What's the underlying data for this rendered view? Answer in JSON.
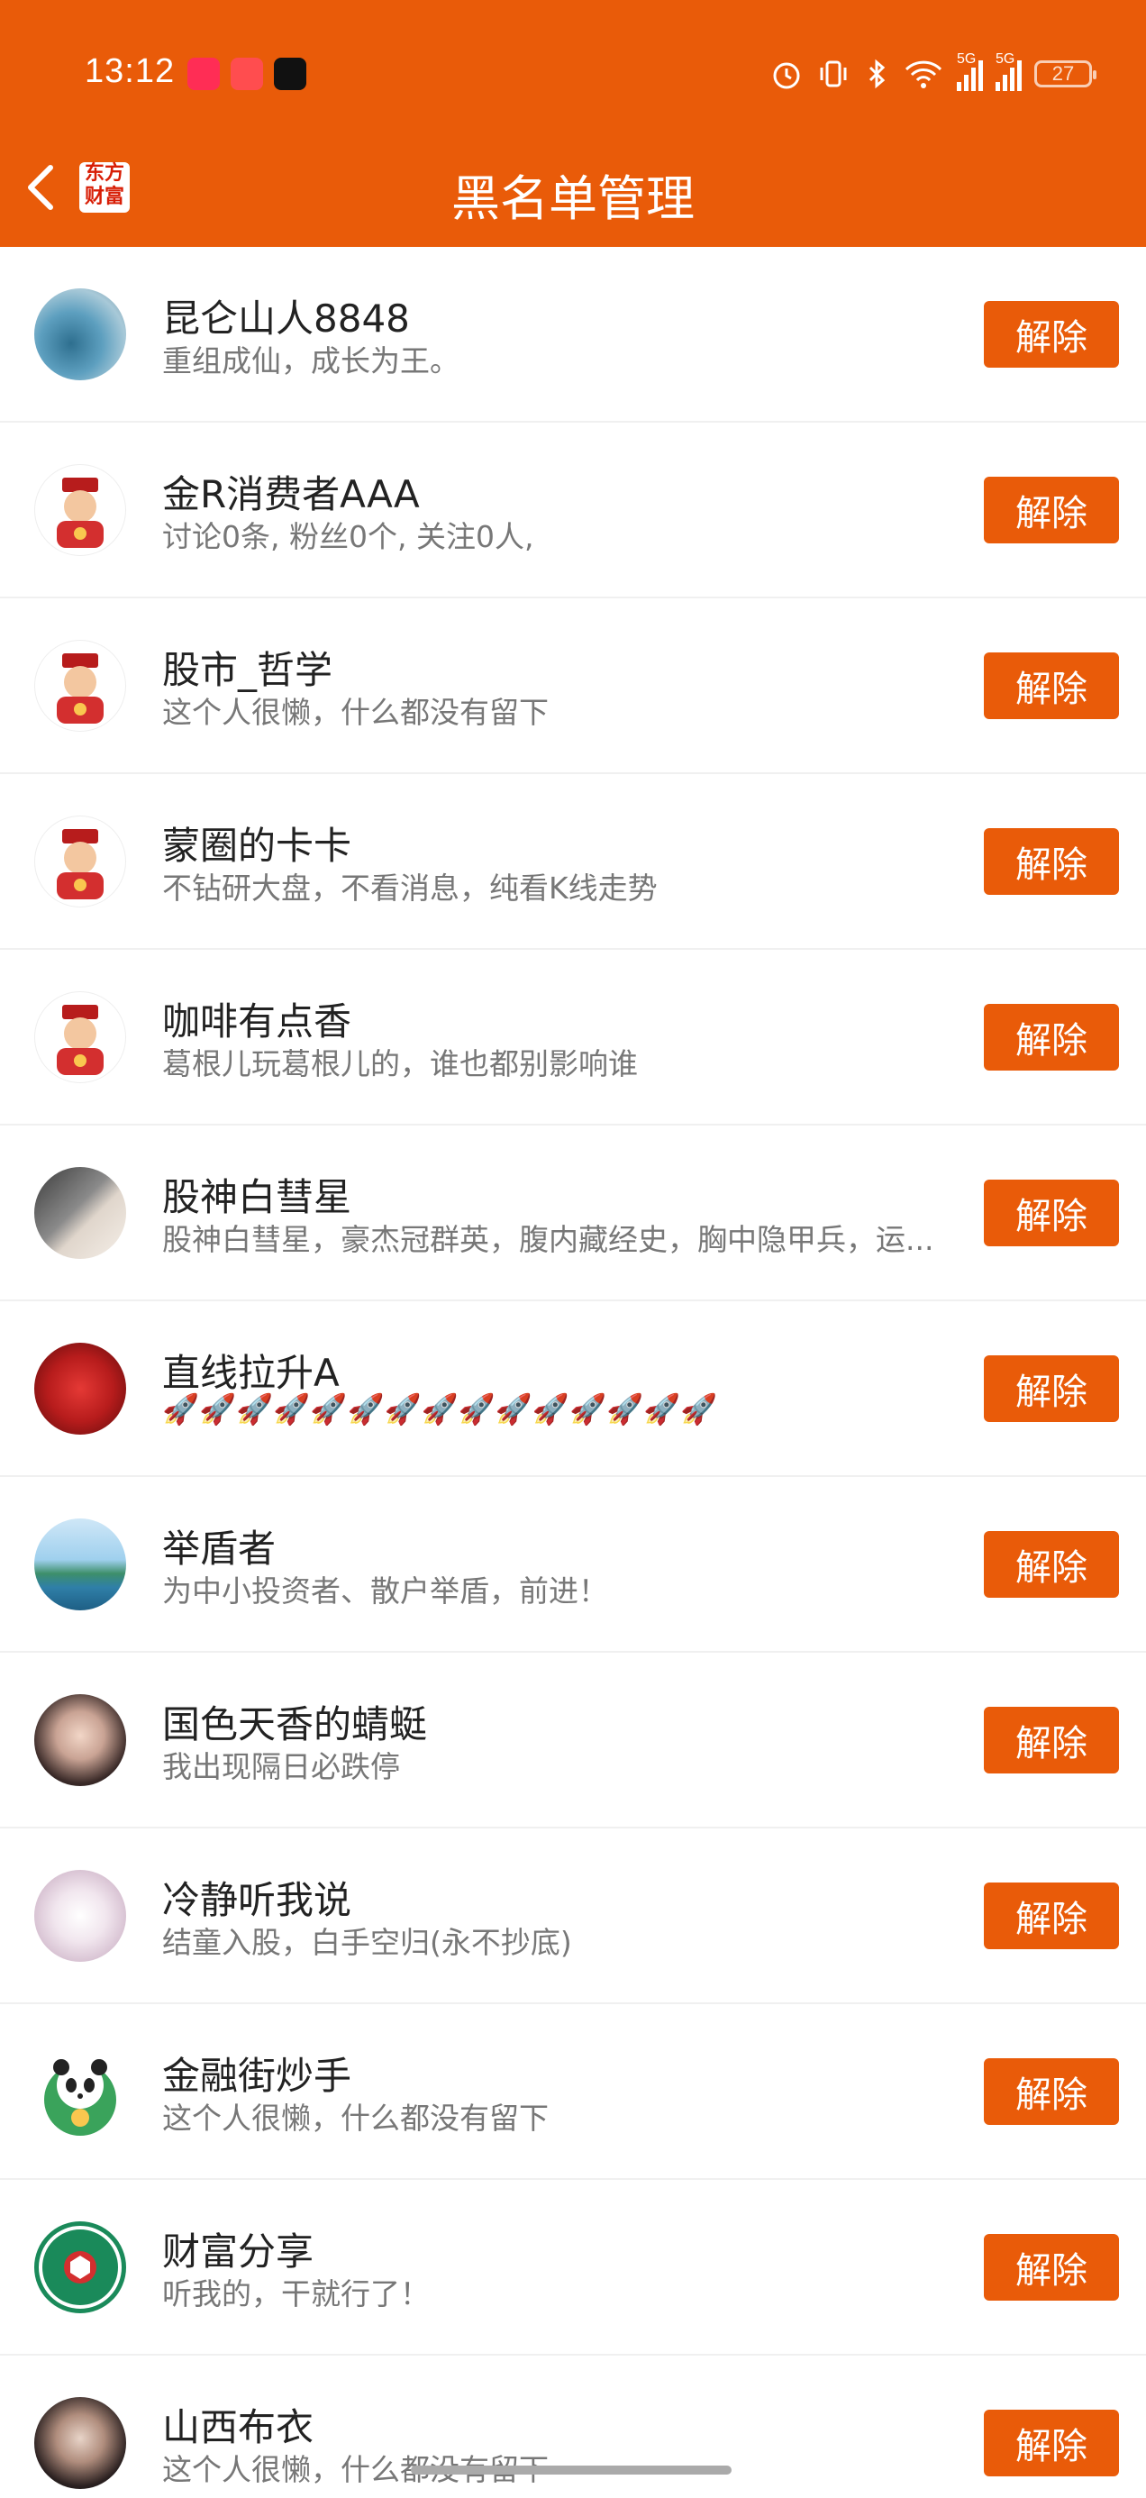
{
  "status_bar": {
    "time": "13:12",
    "battery": "27",
    "network1": "5G",
    "network2": "5G"
  },
  "header": {
    "title": "黑名单管理",
    "logo_line1": "东方",
    "logo_line2": "财富"
  },
  "blocklist": [
    {
      "name": "昆仑山人8848",
      "desc": "重组成仙，成长为王。",
      "avatar": "landscape-aerial"
    },
    {
      "name": "金R消费者AAA",
      "desc": "讨论0条, 粉丝0个, 关注0人,",
      "avatar": "fortune-god"
    },
    {
      "name": "股市_哲学",
      "desc": "这个人很懒，什么都没有留下",
      "avatar": "fortune-god"
    },
    {
      "name": "蒙圈的卡卡",
      "desc": "不钻研大盘，不看消息，纯看K线走势",
      "avatar": "fortune-god"
    },
    {
      "name": "咖啡有点香",
      "desc": "葛根儿玩葛根儿的，谁也都别影响谁",
      "avatar": "fortune-god"
    },
    {
      "name": "股神白彗星",
      "desc": "股神白彗星，豪杰冠群英，腹内藏经史，胸中隐甲兵，运...",
      "avatar": "man-portrait"
    },
    {
      "name": "直线拉升A",
      "desc": "🚀🚀🚀🚀🚀🚀🚀🚀🚀🚀🚀🚀🚀🚀🚀",
      "avatar": "red-roses"
    },
    {
      "name": "举盾者",
      "desc": "为中小投资者、散户举盾，前进！",
      "avatar": "island-sea"
    },
    {
      "name": "国色天香的蜻蜓",
      "desc": "我出现隔日必跌停",
      "avatar": "woman-portrait"
    },
    {
      "name": "冷静听我说",
      "desc": "结童入股，白手空归(永不抄底)",
      "avatar": "anime-girl"
    },
    {
      "name": "金融街炒手",
      "desc": "这个人很懒，什么都没有留下",
      "avatar": "panda"
    },
    {
      "name": "财富分享",
      "desc": "听我的，干就行了！",
      "avatar": "fortuneshare-logo"
    },
    {
      "name": "山西布衣",
      "desc": "这个人很懒，什么都没有留下",
      "avatar": "woman-dark-hair"
    }
  ],
  "unblock_label": "解除",
  "colors": {
    "brand": "#E95B09"
  }
}
